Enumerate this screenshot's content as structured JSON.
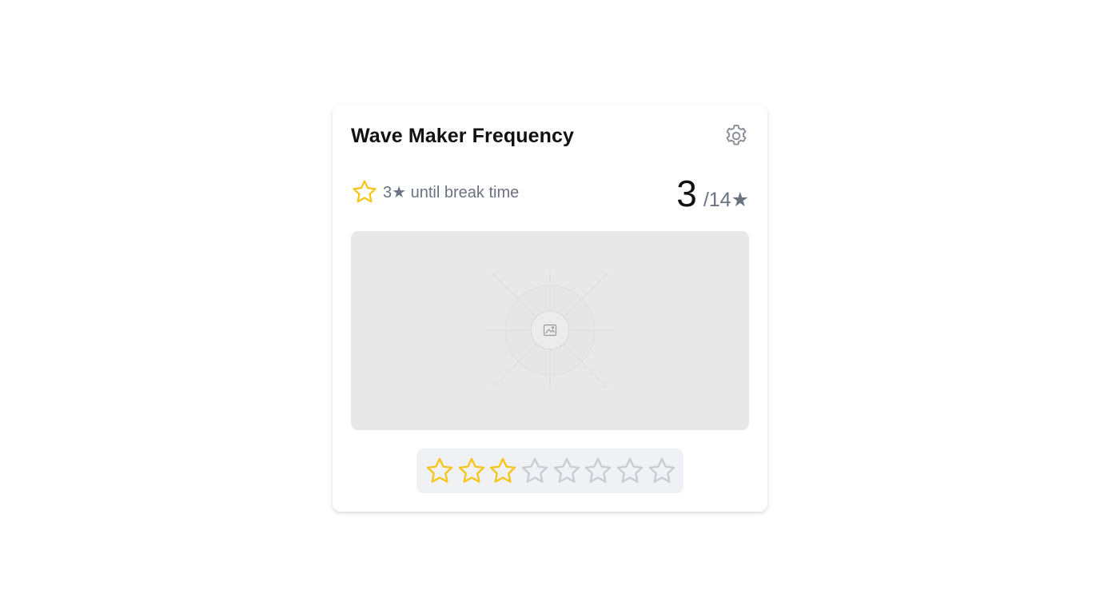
{
  "card": {
    "title": "Wave Maker Frequency",
    "settings_icon": "gear-icon"
  },
  "break_info": {
    "icon": "star-outline-icon",
    "text": "3★ until break time"
  },
  "score": {
    "value": "3",
    "total": "/14★"
  },
  "image": {
    "icon": "image-placeholder-icon"
  },
  "rating": {
    "max": 8,
    "value": 3,
    "filled_color": "#f5c518",
    "empty_color": "#c9ccd2"
  },
  "colors": {
    "accent_star": "#f5c518",
    "muted_text": "#6b7280"
  }
}
